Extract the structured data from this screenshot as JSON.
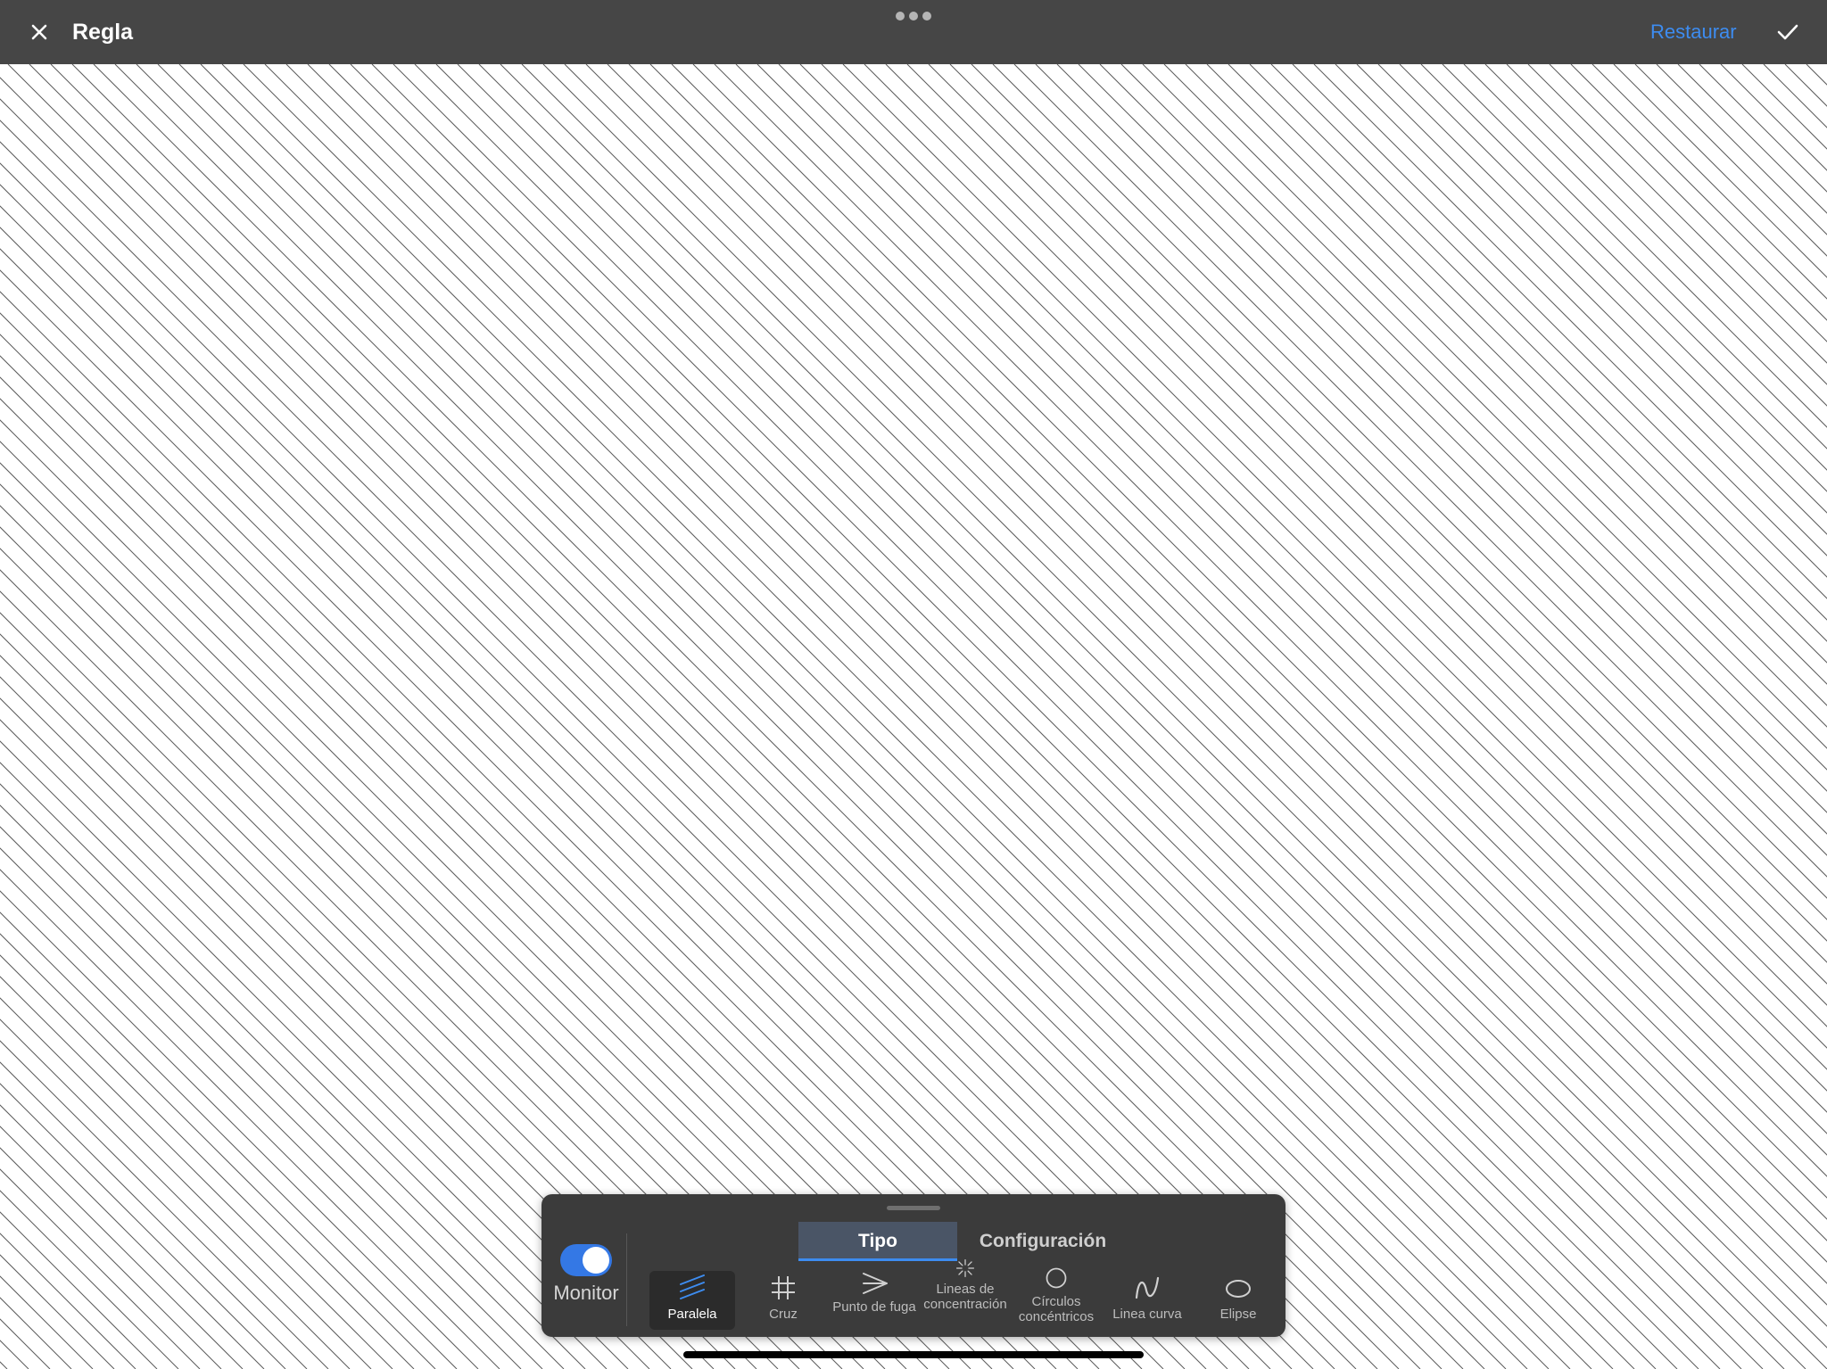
{
  "header": {
    "title": "Regla",
    "restore_label": "Restaurar",
    "close_icon": "close-icon",
    "confirm_icon": "checkmark-icon"
  },
  "canvas": {
    "pattern": "parallel-diagonal-lines",
    "line_color": "#5a5a5a"
  },
  "panel": {
    "monitor": {
      "label": "Monitor",
      "enabled": true
    },
    "tabs": [
      {
        "label": "Tipo",
        "selected": true
      },
      {
        "label": "Configuración",
        "selected": false
      }
    ],
    "tools": [
      {
        "label": "Paralela",
        "icon": "parallel-lines-icon",
        "selected": true
      },
      {
        "label": "Cruz",
        "icon": "grid-cross-icon",
        "selected": false
      },
      {
        "label": "Punto de fuga",
        "icon": "vanishing-point-icon",
        "selected": false
      },
      {
        "label": "Lineas de concentración",
        "icon": "radial-lines-icon",
        "selected": false
      },
      {
        "label": "Círculos concéntricos",
        "icon": "concentric-circle-icon",
        "selected": false
      },
      {
        "label": "Linea curva",
        "icon": "curve-line-icon",
        "selected": false
      },
      {
        "label": "Elipse",
        "icon": "ellipse-icon",
        "selected": false
      }
    ]
  },
  "colors": {
    "accent": "#3d8cf0",
    "toggle_on": "#3478e5",
    "topbar": "#464646",
    "panel": "#3b3b3b"
  }
}
